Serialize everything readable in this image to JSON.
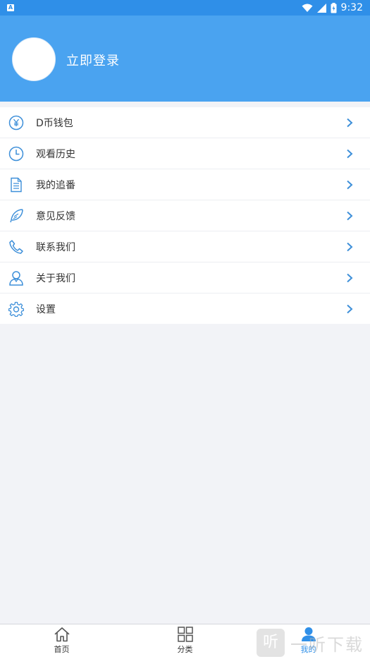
{
  "status_bar": {
    "time": "9:32",
    "notification_icon": "A"
  },
  "header": {
    "login_text": "立即登录"
  },
  "menu": {
    "items": [
      {
        "label": "D币钱包",
        "icon": "yen-circle-icon"
      },
      {
        "label": "观看历史",
        "icon": "clock-icon"
      },
      {
        "label": "我的追番",
        "icon": "document-icon"
      },
      {
        "label": "意见反馈",
        "icon": "feather-icon"
      },
      {
        "label": "联系我们",
        "icon": "phone-icon"
      },
      {
        "label": "关于我们",
        "icon": "user-icon"
      },
      {
        "label": "设置",
        "icon": "gear-icon"
      }
    ]
  },
  "bottom_nav": {
    "tabs": [
      {
        "label": "首页",
        "icon": "home-icon"
      },
      {
        "label": "分类",
        "icon": "grid-icon"
      },
      {
        "label": "我的",
        "icon": "person-icon"
      }
    ],
    "active_index": 2
  },
  "watermark": {
    "badge": "听",
    "text": "一听下载"
  },
  "colors": {
    "accent": "#4aa3f0",
    "statusbar": "#2f8fe8",
    "icon": "#3d8fd9"
  }
}
